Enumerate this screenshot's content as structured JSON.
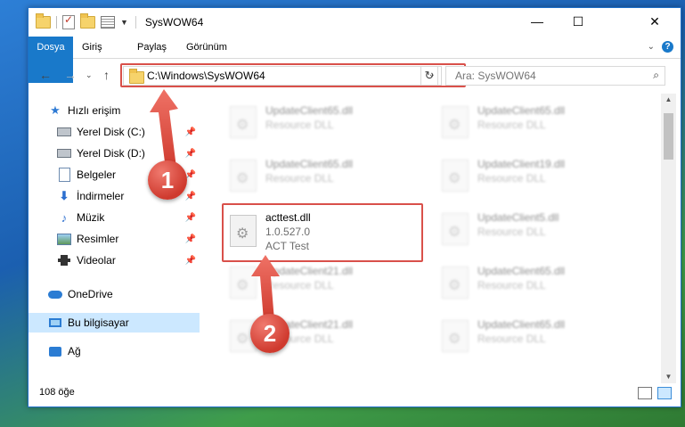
{
  "window": {
    "title": "SysWOW64",
    "controls": {
      "minimize": "—",
      "maximize": "☐",
      "close": "✕"
    }
  },
  "ribbon": {
    "tabs": [
      "Dosya",
      "Giriş",
      "Paylaş",
      "Görünüm"
    ],
    "help": "?"
  },
  "navbar": {
    "path": "C:\\Windows\\SysWOW64",
    "search_placeholder": "Ara: SysWOW64"
  },
  "sidebar": {
    "items": [
      {
        "label": "Hızlı erişim",
        "icon": "star-icon"
      },
      {
        "label": "Yerel Disk (C:)",
        "icon": "drive-icon",
        "pinned": true
      },
      {
        "label": "Yerel Disk (D:)",
        "icon": "drive-icon",
        "pinned": true
      },
      {
        "label": "Belgeler",
        "icon": "document-icon",
        "pinned": true
      },
      {
        "label": "İndirmeler",
        "icon": "download-icon",
        "pinned": true
      },
      {
        "label": "Müzik",
        "icon": "music-icon",
        "pinned": true
      },
      {
        "label": "Resimler",
        "icon": "pictures-icon",
        "pinned": true
      },
      {
        "label": "Videolar",
        "icon": "video-icon",
        "pinned": true
      },
      {
        "label": "OneDrive",
        "icon": "cloud-icon"
      },
      {
        "label": "Bu bilgisayar",
        "icon": "computer-icon",
        "selected": true
      },
      {
        "label": "Ağ",
        "icon": "network-icon"
      }
    ]
  },
  "files": {
    "left": [
      {
        "name": "UpdateClient65.dll",
        "type": "Resource DLL"
      },
      {
        "name": "UpdateClient65.dll",
        "type": "Resource DLL"
      },
      {
        "name": "acttest.dll",
        "version": "1.0.527.0",
        "type": "ACT Test"
      },
      {
        "name": "UpdateClient21.dll",
        "type": "Resource DLL"
      },
      {
        "name": "UpdateClient21.dll",
        "type": "Resource DLL"
      }
    ],
    "right": [
      {
        "name": "UpdateClient65.dll",
        "type": "Resource DLL"
      },
      {
        "name": "UpdateClient19.dll",
        "type": "Resource DLL"
      },
      {
        "name": "UpdateClient5.dll",
        "type": "Resource DLL"
      },
      {
        "name": "UpdateClient65.dll",
        "type": "Resource DLL"
      },
      {
        "name": "UpdateClient65.dll",
        "type": "Resource DLL"
      }
    ]
  },
  "status": {
    "item_count": "108 öğe"
  },
  "annotations": {
    "step1": "1",
    "step2": "2"
  },
  "colors": {
    "accent": "#1979ca",
    "annotation": "#d9504a",
    "selected": "#cce8ff"
  }
}
